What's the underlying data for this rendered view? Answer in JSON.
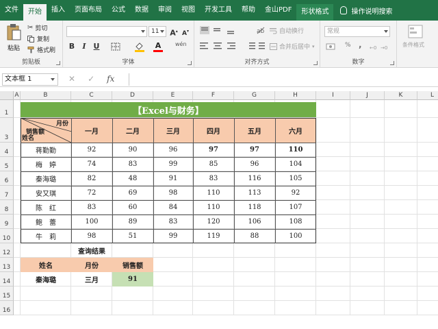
{
  "ribbon_tabs": [
    "文件",
    "开始",
    "插入",
    "页面布局",
    "公式",
    "数据",
    "审阅",
    "视图",
    "开发工具",
    "帮助",
    "金山PDF",
    "形状格式"
  ],
  "active_tab": "开始",
  "tell_me": "操作说明搜索",
  "clipboard": {
    "paste": "粘贴",
    "cut": "剪切",
    "copy": "复制",
    "format_painter": "格式刷",
    "label": "剪贴板"
  },
  "font": {
    "size": "11",
    "bold": "B",
    "italic": "I",
    "underline": "U",
    "grow": "A",
    "shrink": "A",
    "color_letter": "A",
    "wen": "wén",
    "label": "字体"
  },
  "alignment": {
    "wrap": "自动换行",
    "merge": "合并后居中",
    "label": "对齐方式"
  },
  "number": {
    "format": "常规",
    "percent": "%",
    "comma": ",",
    "label": "数字"
  },
  "styles": {
    "conditional": "条件格式"
  },
  "name_box": "文本框 1",
  "formula_bar": {
    "cancel": "✕",
    "enter": "✓",
    "fx": "fx"
  },
  "columns": [
    "A",
    "B",
    "C",
    "D",
    "E",
    "F",
    "G",
    "H",
    "I",
    "J",
    "K",
    "L"
  ],
  "rows": [
    "1",
    "3",
    "4",
    "5",
    "6",
    "7",
    "8",
    "9",
    "10",
    "12",
    "13",
    "14",
    "15",
    "16"
  ],
  "sheet": {
    "title": "【Excel与财务】",
    "diag_header": {
      "top": "月份",
      "mid": "销售额",
      "bottom": "姓名"
    },
    "months": [
      "一月",
      "二月",
      "三月",
      "四月",
      "五月",
      "六月"
    ],
    "records": [
      {
        "name": "蒋勤勤",
        "values": [
          "92",
          "90",
          "96",
          "97",
          "97",
          "110"
        ]
      },
      {
        "name": "梅　婷",
        "values": [
          "74",
          "83",
          "99",
          "85",
          "96",
          "104"
        ]
      },
      {
        "name": "秦海璐",
        "values": [
          "82",
          "48",
          "91",
          "83",
          "116",
          "105"
        ]
      },
      {
        "name": "安又琪",
        "values": [
          "72",
          "69",
          "98",
          "110",
          "113",
          "92"
        ]
      },
      {
        "name": "陈　红",
        "values": [
          "83",
          "60",
          "84",
          "110",
          "118",
          "107"
        ]
      },
      {
        "name": "鲍　蕾",
        "values": [
          "100",
          "89",
          "83",
          "120",
          "106",
          "108"
        ]
      },
      {
        "name": "牛　莉",
        "values": [
          "98",
          "51",
          "99",
          "119",
          "88",
          "100"
        ]
      }
    ],
    "query": {
      "title": "查询结果",
      "headers": [
        "姓名",
        "月份",
        "销售额"
      ],
      "values": [
        "秦海璐",
        "三月",
        "91"
      ]
    }
  },
  "colors": {
    "excel_green": "#217346",
    "title_green": "#70ad47",
    "peach": "#f8cbad",
    "light_green": "#c6e0b4"
  }
}
